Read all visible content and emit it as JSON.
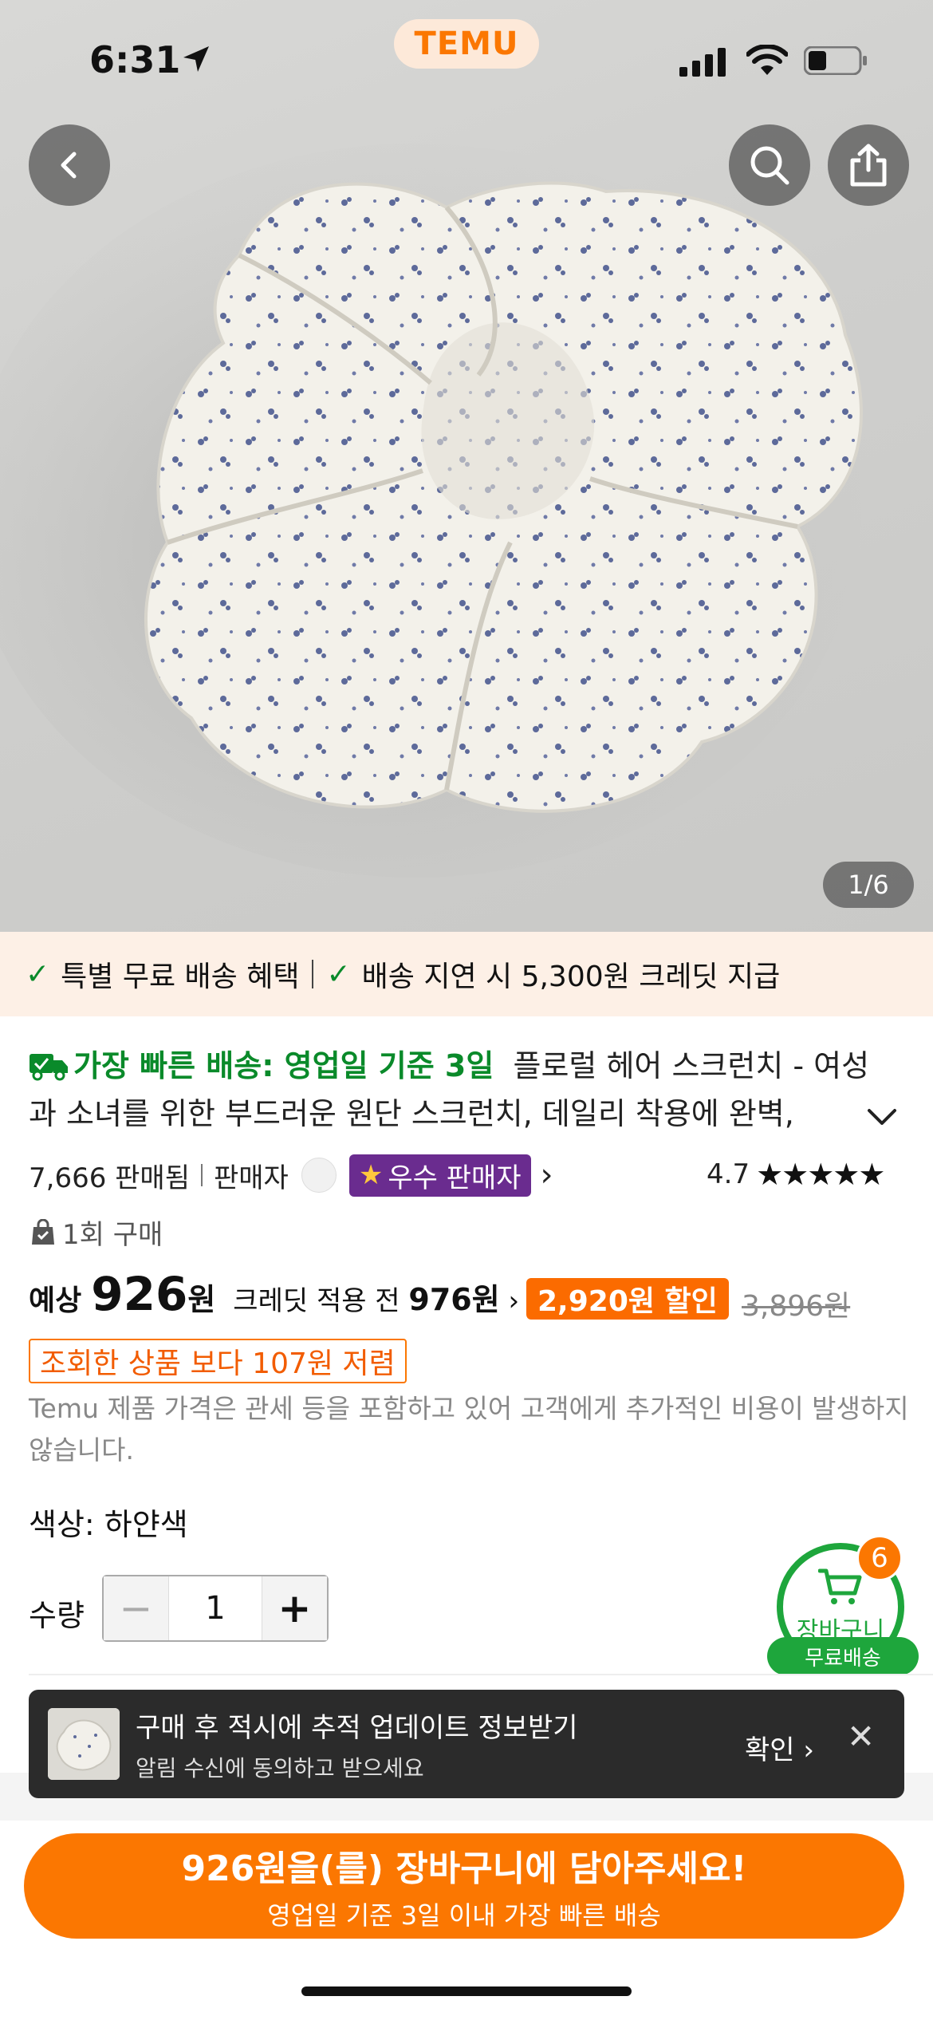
{
  "status_bar": {
    "time": "6:31"
  },
  "header": {
    "brand": "TEMU"
  },
  "gallery": {
    "indicator": "1/6"
  },
  "benefits": {
    "item1": "특별 무료 배송 혜택",
    "item2": "배송 지연 시 5,300원 크레딧 지급"
  },
  "product": {
    "fast_delivery": "가장 빠른 배송: 영업일 기준 3일",
    "title_line1": "플로럴 헤어 스크런치 - 여성",
    "title_line2": "과 소녀를 위한 부드러운 원단 스크런치, 데일리 착용에 완벽,",
    "sold": "7,666 판매됨",
    "seller_label": "판매자",
    "seller_badge": "우수 판매자",
    "rating": "4.7",
    "purchase_count": "1회 구매"
  },
  "price": {
    "prefix": "예상",
    "amount": "926",
    "currency": "원",
    "before_label": "크레딧 적용 전",
    "before_amount": "976원",
    "discount": "2,920원 할인",
    "original": "3,896원",
    "cheaper_note": "조회한 상품 보다 107원 저렴",
    "tax_note": "Temu 제품 가격은 관세 등을 포함하고 있어 고객에게 추가적인 비용이 발생하지 않습니다."
  },
  "options": {
    "color": "색상: 하얀색",
    "qty_label": "수량",
    "qty_value": "1"
  },
  "cart_float": {
    "count": "6",
    "label": "장바구니",
    "free_shipping": "무료배송"
  },
  "toast": {
    "title": "구매 후 적시에 추적 업데이트 정보받기",
    "subtitle": "알림 수신에 동의하고 받으세요",
    "confirm": "확인"
  },
  "cta": {
    "main": "926원을(를) 장바구니에 담아주세요!",
    "sub": "영업일 기준 3일 이내 가장 빠른 배송"
  },
  "colors": {
    "accent": "#fb7701",
    "green": "#1ea63c",
    "seller_badge": "#6a2c8f"
  }
}
